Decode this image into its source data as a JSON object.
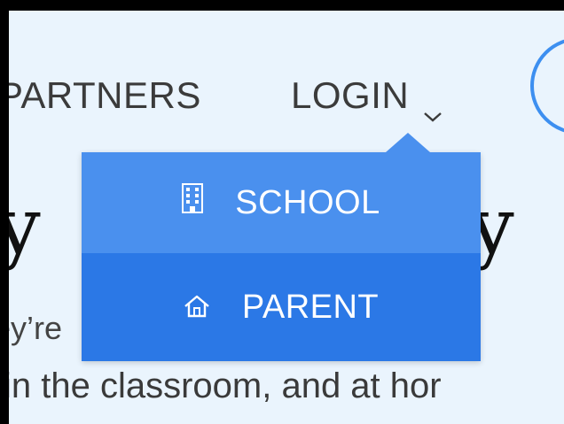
{
  "nav": {
    "partners_label": "PARTNERS",
    "login_label": "LOGIN"
  },
  "dropdown": {
    "items": [
      {
        "label": "SCHOOL",
        "icon": "building-icon"
      },
      {
        "label": "PARENT",
        "icon": "home-icon"
      }
    ]
  },
  "hero": {
    "headline_left": "y",
    "headline_right": "y",
    "subtext_line1": "ey’re",
    "subtext_line2": "in the classroom, and at hor"
  },
  "colors": {
    "background": "#eaf4fd",
    "dropdown_top": "#4a90ee",
    "dropdown_bottom": "#2b78e6",
    "accent_ring": "#3d8ff0"
  }
}
